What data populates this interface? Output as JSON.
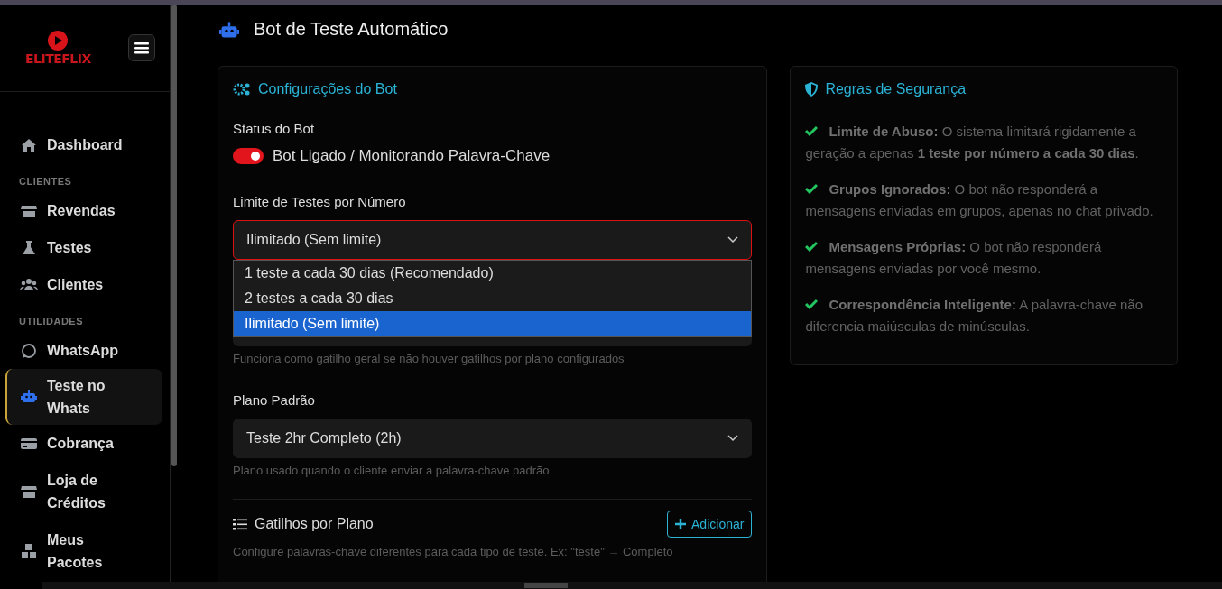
{
  "sidebar": {
    "logo": "ELITEFLIX",
    "items": [
      {
        "kind": "item",
        "label": "Dashboard",
        "selected": false
      },
      {
        "kind": "section",
        "label": "CLIENTES"
      },
      {
        "kind": "item",
        "label": "Revendas",
        "selected": false
      },
      {
        "kind": "item",
        "label": "Testes",
        "selected": false
      },
      {
        "kind": "item",
        "label": "Clientes",
        "selected": false
      },
      {
        "kind": "section",
        "label": "UTILIDADES"
      },
      {
        "kind": "item",
        "label": "WhatsApp",
        "selected": false
      },
      {
        "kind": "item",
        "label": "Teste no Whats",
        "selected": true
      },
      {
        "kind": "item",
        "label": "Cobrança",
        "selected": false
      },
      {
        "kind": "item",
        "label": "Loja de Créditos",
        "selected": false
      },
      {
        "kind": "item",
        "label": "Meus Pacotes",
        "selected": false
      }
    ]
  },
  "page_title": "Bot de Teste Automático",
  "config": {
    "title": "Configurações do Bot",
    "status_label": "Status do Bot",
    "toggle": {
      "label": "Bot Ligado / Monitorando Palavra-Chave",
      "on": true
    },
    "limit": {
      "label": "Limite de Testes por Número",
      "value": "Ilimitado (Sem limite)",
      "expanded": true,
      "options": [
        {
          "label": "1 teste a cada 30 dias (Recomendado)",
          "selected": false
        },
        {
          "label": "2 testes a cada 30 dias",
          "selected": false
        },
        {
          "label": "Ilimitado (Sem limite)",
          "selected": true
        }
      ]
    },
    "keyword_help": "Funciona como gatilho geral se não houver gatilhos por plano configurados",
    "plan": {
      "label": "Plano Padrão",
      "value": "Teste 2hr Completo (2h)",
      "help": "Plano usado quando o cliente enviar a palavra-chave padrão"
    },
    "triggers": {
      "title": "Gatilhos por Plano",
      "button": "Adicionar",
      "help": "Configure palavras-chave diferentes para cada tipo de teste. Ex: \"teste\" → Completo"
    }
  },
  "rules": {
    "title": "Regras de Segurança",
    "items": [
      "**Limite de Abuso:** O sistema limitará rigidamente a geração a apenas **1 teste por número a cada 30 dias**.",
      "**Grupos Ignorados:** O bot não responderá a mensagens enviadas em grupos, apenas no chat privado.",
      "**Mensagens Próprias:** O bot não responderá mensagens enviadas por você mesmo.",
      "**Correspondência Inteligente:** A palavra-chave não diferencia maiúsculas de minúsculas."
    ]
  }
}
